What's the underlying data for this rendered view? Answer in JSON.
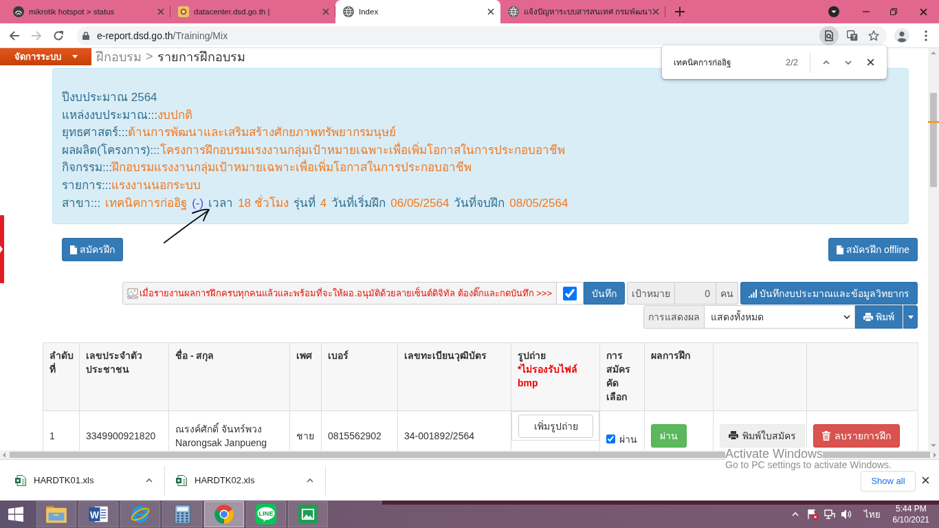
{
  "browser": {
    "tabs": [
      {
        "kind": "mikrotik",
        "title": "mikrotik hotspot > status",
        "selected": false
      },
      {
        "kind": "site",
        "title": "datacenter.dsd.go.th |",
        "selected": false
      },
      {
        "kind": "globe",
        "title": "Index",
        "selected": true
      },
      {
        "kind": "globe",
        "title": "แจ้งปัญหาระบบสารสนเทศ กรมพัฒนา",
        "selected": false
      }
    ],
    "address": {
      "host": "e-report.dsd.go.th",
      "path": "/Training/Mix"
    }
  },
  "find_bar": {
    "query": "เทคนิคการก่ออิฐ",
    "count": "2/2"
  },
  "page": {
    "admin_menu": "จัดการระบบ",
    "breadcrumb": {
      "items": [
        {
          "label": "ฝึกอบรม",
          "selected": false
        },
        {
          "label": "รายการฝึกอบรม",
          "selected": true
        }
      ],
      "separator": ">"
    },
    "info": [
      {
        "segments": [
          {
            "kind": "label",
            "text": "ปีงบประมาณ 2564"
          }
        ]
      },
      {
        "segments": [
          {
            "kind": "label",
            "text": "แหล่งงบประมาณ:::"
          },
          {
            "kind": "value",
            "text": "งบปกติ"
          }
        ]
      },
      {
        "segments": [
          {
            "kind": "label",
            "text": "ยุทธศาสตร์:::"
          },
          {
            "kind": "value",
            "text": "ด้านการพัฒนาและเสริมสร้างศักยภาพทรัพยากรมนุษย์"
          }
        ]
      },
      {
        "segments": [
          {
            "kind": "label",
            "text": "ผลผลิต(โครงการ):::"
          },
          {
            "kind": "value",
            "text": "โครงการฝึกอบรมแรงงานกลุ่มเป้าหมายเฉพาะเพื่อเพิ่มโอกาสในการประกอบอาชีพ"
          }
        ]
      },
      {
        "segments": [
          {
            "kind": "label",
            "text": "กิจกรรม:::"
          },
          {
            "kind": "value",
            "text": "ฝึกอบรมแรงงานกลุ่มเป้าหมายเฉพาะเพื่อเพิ่มโอกาสในการประกอบอาชีพ"
          }
        ]
      },
      {
        "segments": [
          {
            "kind": "label",
            "text": "รายการ:::"
          },
          {
            "kind": "value",
            "text": "แรงงานนอกระบบ"
          }
        ]
      },
      {
        "segments": [
          {
            "kind": "label",
            "text": "สาขา:::"
          },
          {
            "kind": "value",
            "text": "เทคนิคการก่ออิฐ"
          },
          {
            "kind": "code",
            "text": "(-)"
          },
          {
            "kind": "label",
            "text": "เวลา"
          },
          {
            "kind": "value",
            "text": "18 ชั่วโมง"
          },
          {
            "kind": "label",
            "text": "รุ่นที่"
          },
          {
            "kind": "value",
            "text": "4"
          },
          {
            "kind": "label",
            "text": "วันที่เริ่มฝึก"
          },
          {
            "kind": "value",
            "text": "06/05/2564"
          },
          {
            "kind": "label",
            "text": "วันที่จบฝึก"
          },
          {
            "kind": "value",
            "text": "08/05/2564"
          }
        ]
      }
    ],
    "register_buttons": [
      "สมัครฝึก",
      "สมัครฝึก offline"
    ],
    "approval": {
      "notice": "เมื่อรายงานผลการฝึกครบทุกคนแล้วและพร้อมที่จะให้ผอ.อนุมัติด้วยลายเซ็นต์ดิจิทัล ต้องติ๊กและกดบันทึก >>>",
      "checked": true,
      "save": "บันทึก"
    },
    "target": {
      "label": "เป้าหมาย",
      "value": "0",
      "unit": "คน"
    },
    "budget_button": "บันทึกงบประมาณและข้อมูลวิทยากร",
    "display": {
      "label": "การแสดงผล",
      "value": "แสดงทั้งหมด"
    },
    "print_button": "พิมพ์",
    "table": {
      "columns": [
        {
          "label": "ลำดับที่"
        },
        {
          "label": "เลขประจำตัวประชาชน"
        },
        {
          "label": "ชื่อ - สกุล"
        },
        {
          "label": "เพศ"
        },
        {
          "label": "เบอร์"
        },
        {
          "label": "เลขทะเบียนวุฒิบัตร"
        },
        {
          "label": "รูปถ่าย",
          "note": "*ไม่รองรับไฟล์ bmp"
        },
        {
          "label": "การสมัครคัดเลือก"
        },
        {
          "label": "ผลการฝึก"
        }
      ],
      "rows": [
        {
          "cells": [
            {
              "kind": "text",
              "text": "1"
            },
            {
              "kind": "text",
              "text": "3349900921820"
            },
            {
              "kind": "lines",
              "lines": [
                "ณรงค์ศักดิ์ จันทร์พวง",
                "Narongsak Janpueng"
              ]
            },
            {
              "kind": "text",
              "text": "ชาย"
            },
            {
              "kind": "text",
              "text": "0815562902"
            },
            {
              "kind": "text",
              "text": "34-001892/2564"
            },
            {
              "kind": "upload",
              "text": "เพิ่มรูปถ่าย"
            },
            {
              "kind": "check",
              "checked": true,
              "text": "ผ่าน"
            },
            {
              "kind": "pass",
              "text": "ผ่าน"
            },
            {
              "kind": "print",
              "text": "พิมพ์ใบสมัคร"
            },
            {
              "kind": "delete",
              "text": "ลบรายการฝึก"
            }
          ]
        }
      ]
    }
  },
  "downloads": {
    "items": [
      {
        "name": "HARDTK01.xls"
      },
      {
        "name": "HARDTK02.xls"
      }
    ],
    "show_all": "Show all"
  },
  "activation": {
    "title": "Activate Windows",
    "message": "Go to PC settings to activate Windows."
  },
  "taskbar": {
    "apps": [
      {
        "kind": "explorer",
        "selected": false
      },
      {
        "kind": "word",
        "logo_text": "W",
        "selected": false
      },
      {
        "kind": "ie",
        "selected": false
      },
      {
        "kind": "calculator",
        "selected": false
      },
      {
        "kind": "chrome",
        "selected": true
      },
      {
        "kind": "line",
        "logo_text": "LINE",
        "selected": false
      },
      {
        "kind": "photos",
        "selected": false
      }
    ],
    "tray": {
      "language": "ไทย",
      "time": "5:44 PM",
      "date": "6/10/2021"
    }
  }
}
